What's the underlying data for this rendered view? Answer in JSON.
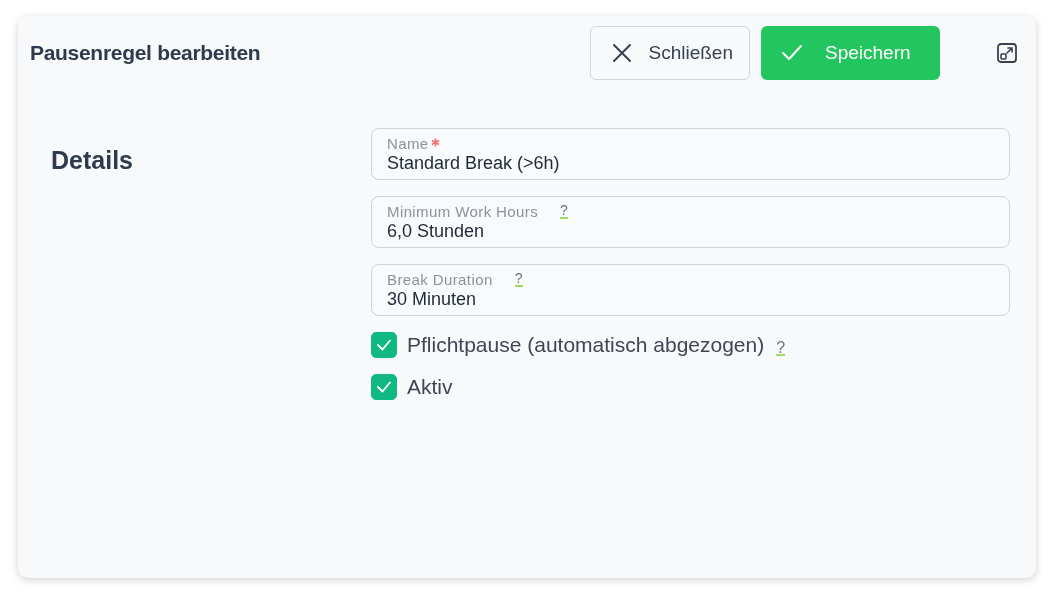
{
  "dialog": {
    "title": "Pausenregel bearbeiten",
    "buttons": [
      {
        "kind": "close",
        "label": "Schließen"
      },
      {
        "kind": "save",
        "label": "Speichern"
      }
    ]
  },
  "section": {
    "title": "Details"
  },
  "fields": [
    {
      "label": "Name",
      "required": true,
      "value": "Standard Break (>6h)"
    },
    {
      "label": "Minimum Work Hours",
      "required": false,
      "help": "?",
      "value": "6,0 Stunden"
    },
    {
      "label": "Break Duration",
      "required": false,
      "help": "?",
      "value": "30 Minuten"
    }
  ],
  "checkboxes": [
    {
      "label": "Pflichtpause (automatisch abgezogen)",
      "checked": true,
      "help": "?"
    },
    {
      "label": "Aktiv",
      "checked": true
    }
  ]
}
